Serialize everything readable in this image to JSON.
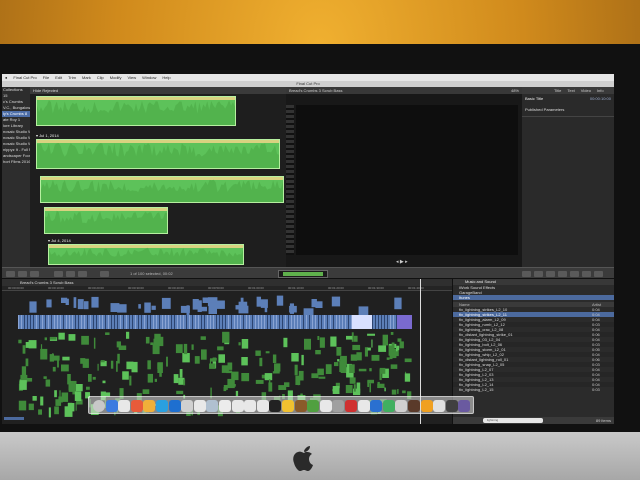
{
  "menubar": {
    "items": [
      "Final Cut Pro",
      "File",
      "Edit",
      "Trim",
      "Mark",
      "Clip",
      "Modify",
      "View",
      "Window",
      "Help"
    ]
  },
  "window": {
    "title": "Final Cut Pro"
  },
  "libraries": [
    {
      "label": "Collections",
      "selected": false
    },
    {
      "label": "15",
      "selected": false
    },
    {
      "label": "c's Crumbs",
      "selected": false
    },
    {
      "label": "V.C., Bungalow",
      "selected": false
    },
    {
      "label": "ly's Crumbs 8",
      "selected": true
    },
    {
      "label": "ate Roy 1",
      "selected": false
    },
    {
      "label": "lore Library",
      "selected": false
    },
    {
      "label": "nosaic Studio W 5",
      "selected": false
    },
    {
      "label": "nosaic Studio W 6",
      "selected": false
    },
    {
      "label": "nosaic Studio W 8",
      "selected": false
    },
    {
      "label": "nippyz It - Full Movie",
      "selected": false
    },
    {
      "label": "andscaper Footage",
      "selected": false
    },
    {
      "label": "hort Films 2016",
      "selected": false
    }
  ],
  "browser": {
    "filter": "Hide Rejected",
    "dates": [
      "Jul 1, 2014",
      "Jul 4, 2014"
    ],
    "clip_count_label": "1 of 100 selected, 00:02"
  },
  "viewer": {
    "zoom": "48%",
    "title": "Bread's Crumbs 3 Scrub Bass"
  },
  "inspector": {
    "tabs": [
      "Title",
      "Text",
      "Video",
      "Info"
    ],
    "clip_name": "Basic Title",
    "clip_time": "00:00:10:00",
    "section": "Published Parameters"
  },
  "timeline": {
    "title": "Bread's Crumbs 3 Scrub Bass",
    "ruler": [
      "00:00:00:00",
      "00:00:10:00",
      "00:00:20:00",
      "00:00:30:00",
      "00:00:40:00",
      "00:00:50:00",
      "00:01:00:00",
      "00:01:10:00",
      "00:01:20:00",
      "00:01:30:00",
      "00:01:40:00"
    ]
  },
  "media_browser": {
    "header": "Music and Sound",
    "sources": [
      {
        "label": "iWork Sound Effects",
        "selected": false
      },
      {
        "label": "GarageBand",
        "selected": false
      },
      {
        "label": "Itunes",
        "selected": true
      }
    ],
    "columns": [
      "Name",
      "Artist"
    ],
    "files": [
      {
        "name": "fix_lightning_strikes_L2_10",
        "time": "0:04",
        "selected": false
      },
      {
        "name": "fix_lightning_strikes_L2_11",
        "time": "0:04",
        "selected": true
      },
      {
        "name": "fix_lightning_alarm_L2_09",
        "time": "0:04",
        "selected": false
      },
      {
        "name": "fix_lightning_rumb_L2_12",
        "time": "0:03",
        "selected": false
      },
      {
        "name": "fix_lightning_crac_L2_08",
        "time": "0:04",
        "selected": false
      },
      {
        "name": "fix_distant_lightning_strike_01",
        "time": "0:06",
        "selected": false
      },
      {
        "name": "fix_lightning_03_L2_04",
        "time": "0:04",
        "selected": false
      },
      {
        "name": "fix_lightning_bolt_L2_06",
        "time": "0:03",
        "selected": false
      },
      {
        "name": "fix_lightning_storm_L2_01",
        "time": "0:05",
        "selected": false
      },
      {
        "name": "fix_lightning_whip_L2_02",
        "time": "0:04",
        "selected": false
      },
      {
        "name": "fix_distant_lightning_roll_01",
        "time": "0:06",
        "selected": false
      },
      {
        "name": "fix_lightning_snap_L2_05",
        "time": "0:03",
        "selected": false
      },
      {
        "name": "fix_lightning_L2_07",
        "time": "0:04",
        "selected": false
      },
      {
        "name": "fix_lightning_L2_03",
        "time": "0:04",
        "selected": false
      },
      {
        "name": "fix_lightning_L2_13",
        "time": "0:04",
        "selected": false
      },
      {
        "name": "fix_lightning_L2_14",
        "time": "0:04",
        "selected": false
      },
      {
        "name": "fix_lightning_L2_15",
        "time": "0:03",
        "selected": false
      }
    ],
    "search_placeholder": "lightning",
    "count": "89 items"
  },
  "dock": {
    "colors": [
      "#c8c8c8",
      "#3b7be0",
      "#e8e8e8",
      "#e85b3a",
      "#f0b03a",
      "#2aa0e0",
      "#1e6fd0",
      "#d0d0d0",
      "#e8e8e8",
      "#b0c0d0",
      "#ececec",
      "#e8e8e8",
      "#e8e8e8",
      "#e8e8e8",
      "#222222",
      "#f0c030",
      "#8a5a2a",
      "#50a040",
      "#e8e8e8",
      "#a0a0a0",
      "#d03030",
      "#e8e8e8",
      "#2a70d0",
      "#40b060",
      "#d0d0d0",
      "#5a3a2a",
      "#f0a020",
      "#e0e0e0",
      "#404040",
      "#6a5aa0"
    ]
  },
  "colors": {
    "clip_green": "#5dc25a",
    "selection_blue": "#4c6a9e",
    "connected_blue": "#5c7fb8"
  }
}
